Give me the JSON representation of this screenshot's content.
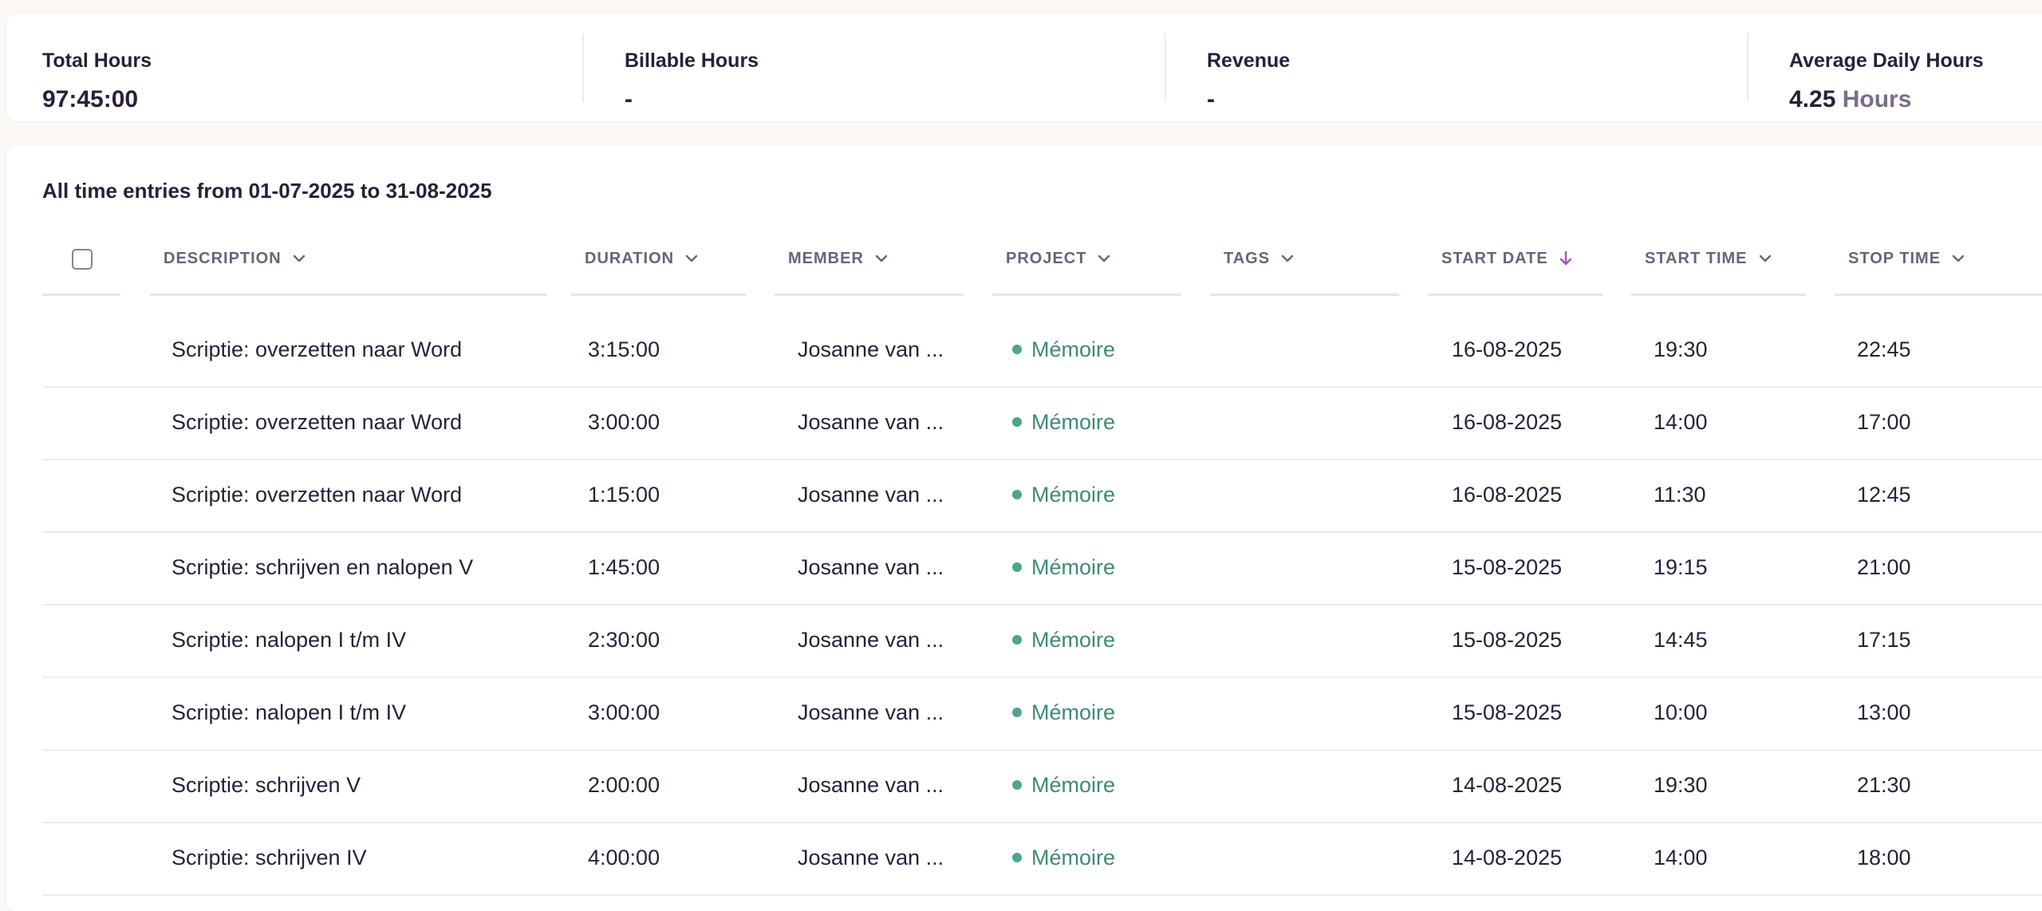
{
  "stats": [
    {
      "label": "Total Hours",
      "value": "97:45:00",
      "unit": ""
    },
    {
      "label": "Billable Hours",
      "value": "-",
      "unit": ""
    },
    {
      "label": "Revenue",
      "value": "-",
      "unit": ""
    },
    {
      "label": "Average Daily Hours",
      "value": "4.25",
      "unit": "Hours"
    }
  ],
  "entries": {
    "title": "All time entries from 01-07-2025 to 31-08-2025",
    "columns": [
      {
        "key": "description",
        "label": "DESCRIPTION",
        "icon": "chevron-down-icon"
      },
      {
        "key": "duration",
        "label": "DURATION",
        "icon": "chevron-down-icon"
      },
      {
        "key": "member",
        "label": "MEMBER",
        "icon": "chevron-down-icon"
      },
      {
        "key": "project",
        "label": "PROJECT",
        "icon": "chevron-down-icon"
      },
      {
        "key": "tags",
        "label": "TAGS",
        "icon": "chevron-down-icon"
      },
      {
        "key": "start_date",
        "label": "START DATE",
        "icon": "arrow-down-icon",
        "sort": "descending"
      },
      {
        "key": "start_time",
        "label": "START TIME",
        "icon": "chevron-down-icon"
      },
      {
        "key": "stop_time",
        "label": "STOP TIME",
        "icon": "chevron-down-icon"
      }
    ],
    "rows": [
      {
        "description": "Scriptie: overzetten naar Word",
        "duration": "3:15:00",
        "member": "Josanne van ...",
        "project": "Mémoire",
        "tags": "",
        "start_date": "16-08-2025",
        "start_time": "19:30",
        "stop_time": "22:45"
      },
      {
        "description": "Scriptie: overzetten naar Word",
        "duration": "3:00:00",
        "member": "Josanne van ...",
        "project": "Mémoire",
        "tags": "",
        "start_date": "16-08-2025",
        "start_time": "14:00",
        "stop_time": "17:00"
      },
      {
        "description": "Scriptie: overzetten naar Word",
        "duration": "1:15:00",
        "member": "Josanne van ...",
        "project": "Mémoire",
        "tags": "",
        "start_date": "16-08-2025",
        "start_time": "11:30",
        "stop_time": "12:45"
      },
      {
        "description": "Scriptie: schrijven en nalopen V",
        "duration": "1:45:00",
        "member": "Josanne van ...",
        "project": "Mémoire",
        "tags": "",
        "start_date": "15-08-2025",
        "start_time": "19:15",
        "stop_time": "21:00"
      },
      {
        "description": "Scriptie: nalopen I t/m IV",
        "duration": "2:30:00",
        "member": "Josanne van ...",
        "project": "Mémoire",
        "tags": "",
        "start_date": "15-08-2025",
        "start_time": "14:45",
        "stop_time": "17:15"
      },
      {
        "description": "Scriptie: nalopen I t/m IV",
        "duration": "3:00:00",
        "member": "Josanne van ...",
        "project": "Mémoire",
        "tags": "",
        "start_date": "15-08-2025",
        "start_time": "10:00",
        "stop_time": "13:00"
      },
      {
        "description": "Scriptie: schrijven V",
        "duration": "2:00:00",
        "member": "Josanne van ...",
        "project": "Mémoire",
        "tags": "",
        "start_date": "14-08-2025",
        "start_time": "19:30",
        "stop_time": "21:30"
      },
      {
        "description": "Scriptie: schrijven IV",
        "duration": "4:00:00",
        "member": "Josanne van ...",
        "project": "Mémoire",
        "tags": "",
        "start_date": "14-08-2025",
        "start_time": "14:00",
        "stop_time": "18:00"
      }
    ]
  },
  "colors": {
    "text": "#2a1f38",
    "muted": "#6c617a",
    "project_text": "#3d8a73",
    "project_dot": "#4da58c",
    "sort_arrow": "#b04fc4",
    "background": "#fcf8f5"
  }
}
